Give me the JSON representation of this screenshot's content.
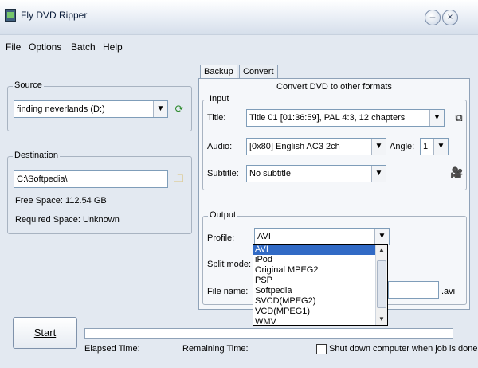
{
  "window": {
    "title": "Fly DVD Ripper",
    "minimize": "–",
    "close": "×"
  },
  "menu": [
    "File",
    "Options",
    "Batch",
    "Help"
  ],
  "source": {
    "label": "Source",
    "drive": "finding neverlands (D:)"
  },
  "destination": {
    "label": "Destination",
    "path": "C:\\Softpedia\\",
    "free_space": "Free Space: 112.54 GB",
    "required_space": "Required Space: Unknown"
  },
  "tabs": [
    "Backup",
    "Convert"
  ],
  "panel_title": "Convert DVD to other formats",
  "input": {
    "label": "Input",
    "title_label": "Title:",
    "title_value": "Title 01 [01:36:59], PAL 4:3, 12 chapters",
    "audio_label": "Audio:",
    "audio_value": "[0x80] English AC3 2ch",
    "angle_label": "Angle:",
    "angle_value": "1",
    "subtitle_label": "Subtitle:",
    "subtitle_value": "No subtitle"
  },
  "output": {
    "label": "Output",
    "profile_label": "Profile:",
    "profile_value": "AVI",
    "split_label": "Split mode:",
    "filename_label": "File name:",
    "filename_ext": ".avi",
    "profile_options": [
      "AVI",
      "iPod",
      "Original MPEG2",
      "PSP",
      "Softpedia",
      "SVCD(MPEG2)",
      "VCD(MPEG1)",
      "WMV"
    ],
    "selected_index": 0
  },
  "bottom": {
    "start_label": "Start",
    "elapsed_label": "Elapsed Time:",
    "remaining_label": "Remaining Time:",
    "shutdown_label": "Shut down computer when job is done",
    "progress_fraction": 0
  },
  "colors": {
    "accent": "#316ac5",
    "progress": "#76c66a",
    "window_bg": "#e3e9f1"
  }
}
